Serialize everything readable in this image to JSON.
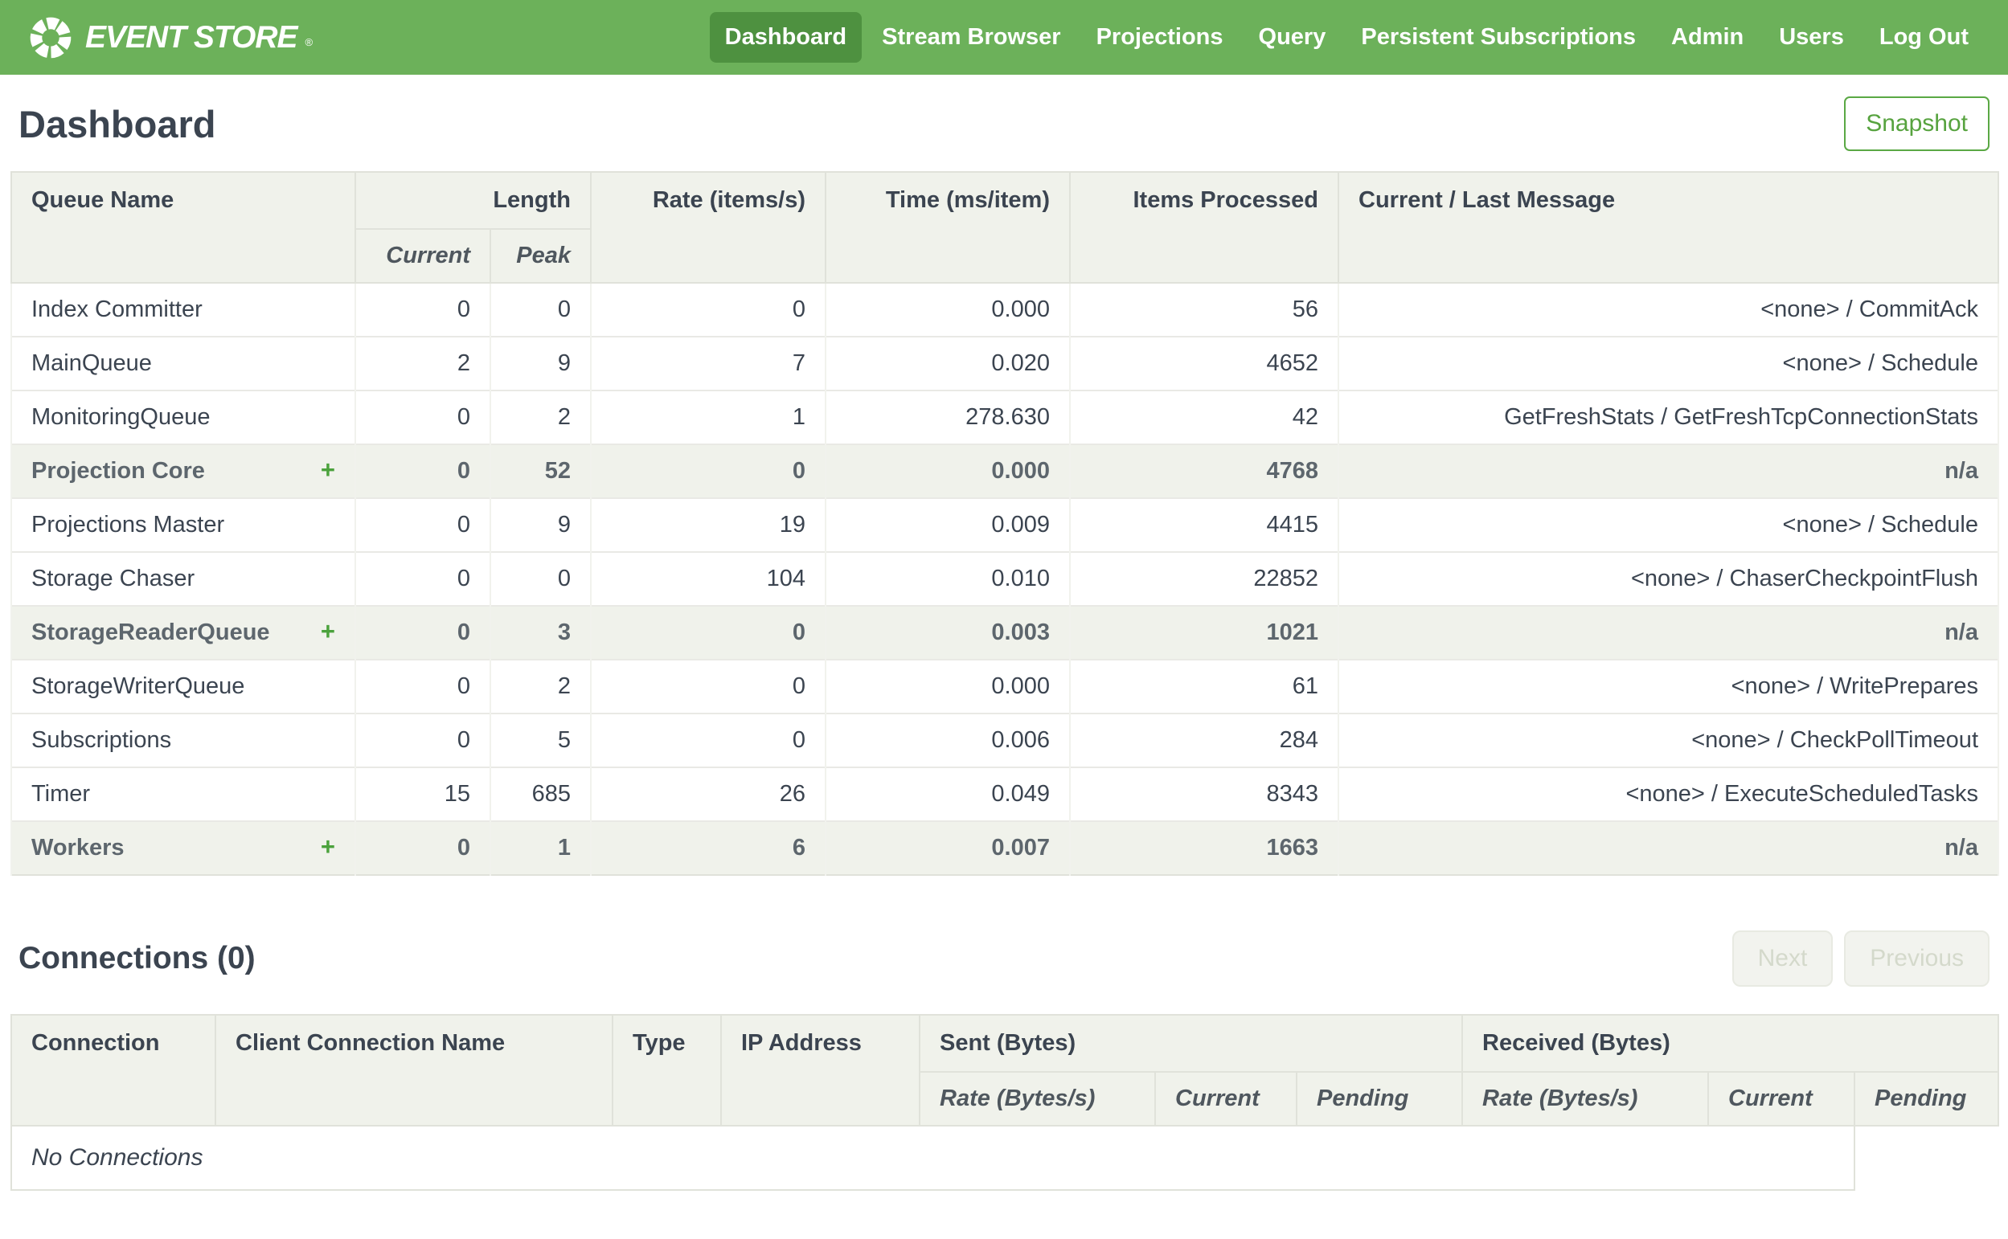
{
  "nav": {
    "brand": "EVENT STORE",
    "registered_mark": "®",
    "items": [
      {
        "label": "Dashboard",
        "active": true
      },
      {
        "label": "Stream Browser",
        "active": false
      },
      {
        "label": "Projections",
        "active": false
      },
      {
        "label": "Query",
        "active": false
      },
      {
        "label": "Persistent Subscriptions",
        "active": false
      },
      {
        "label": "Admin",
        "active": false
      },
      {
        "label": "Users",
        "active": false
      },
      {
        "label": "Log Out",
        "active": false
      }
    ]
  },
  "page": {
    "title": "Dashboard",
    "snapshot_button": "Snapshot"
  },
  "queue_table": {
    "headers": {
      "queue_name": "Queue Name",
      "length": "Length",
      "current": "Current",
      "peak": "Peak",
      "rate": "Rate (items/s)",
      "time": "Time (ms/item)",
      "items_processed": "Items Processed",
      "message": "Current / Last Message"
    },
    "expander": "+",
    "rows": [
      {
        "name": "Index Committer",
        "current": "0",
        "peak": "0",
        "rate": "0",
        "time": "0.000",
        "items": "56",
        "message": "<none> / CommitAck"
      },
      {
        "name": "MainQueue",
        "current": "2",
        "peak": "9",
        "rate": "7",
        "time": "0.020",
        "items": "4652",
        "message": "<none> / Schedule"
      },
      {
        "name": "MonitoringQueue",
        "current": "0",
        "peak": "2",
        "rate": "1",
        "time": "278.630",
        "items": "42",
        "message": "GetFreshStats / GetFreshTcpConnectionStats"
      },
      {
        "name": "Projection Core",
        "current": "0",
        "peak": "52",
        "rate": "0",
        "time": "0.000",
        "items": "4768",
        "message": "n/a"
      },
      {
        "name": "Projections Master",
        "current": "0",
        "peak": "9",
        "rate": "19",
        "time": "0.009",
        "items": "4415",
        "message": "<none> / Schedule"
      },
      {
        "name": "Storage Chaser",
        "current": "0",
        "peak": "0",
        "rate": "104",
        "time": "0.010",
        "items": "22852",
        "message": "<none> / ChaserCheckpointFlush"
      },
      {
        "name": "StorageReaderQueue",
        "current": "0",
        "peak": "3",
        "rate": "0",
        "time": "0.003",
        "items": "1021",
        "message": "n/a"
      },
      {
        "name": "StorageWriterQueue",
        "current": "0",
        "peak": "2",
        "rate": "0",
        "time": "0.000",
        "items": "61",
        "message": "<none> / WritePrepares"
      },
      {
        "name": "Subscriptions",
        "current": "0",
        "peak": "5",
        "rate": "0",
        "time": "0.006",
        "items": "284",
        "message": "<none> / CheckPollTimeout"
      },
      {
        "name": "Timer",
        "current": "15",
        "peak": "685",
        "rate": "26",
        "time": "0.049",
        "items": "8343",
        "message": "<none> / ExecuteScheduledTasks"
      },
      {
        "name": "Workers",
        "current": "0",
        "peak": "1",
        "rate": "6",
        "time": "0.007",
        "items": "1663",
        "message": "n/a"
      }
    ]
  },
  "connections": {
    "title": "Connections (0)",
    "next_button": "Next",
    "previous_button": "Previous",
    "headers": {
      "connection": "Connection",
      "client_name": "Client Connection Name",
      "type": "Type",
      "ip": "IP Address",
      "sent": "Sent (Bytes)",
      "received": "Received (Bytes)",
      "rate": "Rate (Bytes/s)",
      "current": "Current",
      "pending": "Pending"
    },
    "empty_message": "No Connections"
  },
  "colors": {
    "nav_green": "#6cb15a",
    "nav_active_green": "#4e9140",
    "accent_green": "#57a33f",
    "header_bg": "#f0f2eb",
    "text": "#3b4450"
  }
}
